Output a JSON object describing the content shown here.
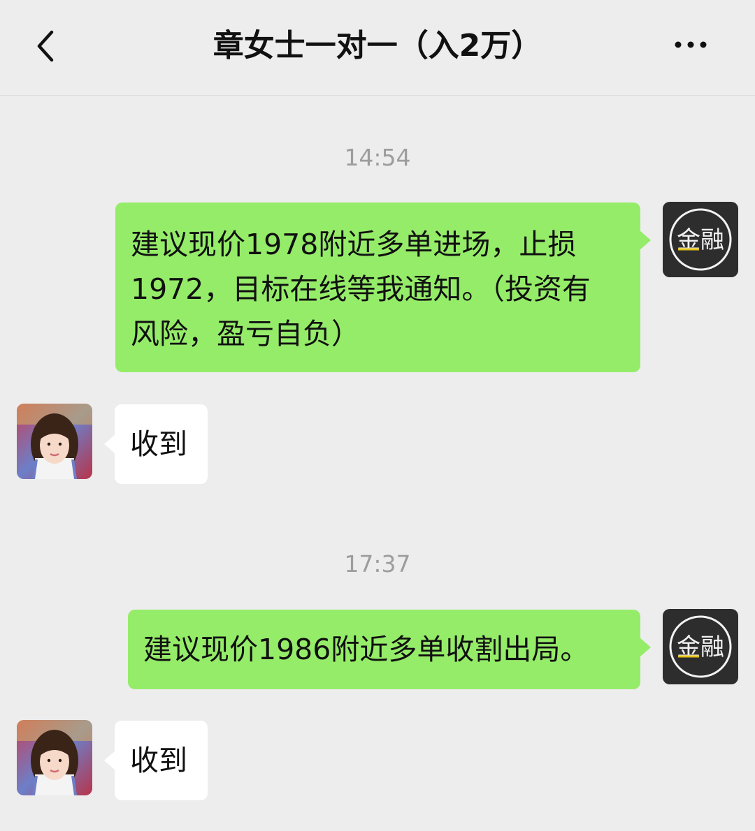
{
  "header": {
    "title": "章女士一对一（入2万）"
  },
  "messages": [
    {
      "type": "time",
      "text": "14:54"
    },
    {
      "type": "outgoing",
      "text": "建议现价1978附近多单进场，止损1972，目标在线等我通知。（投资有风险，盈亏自负）"
    },
    {
      "type": "incoming",
      "text": "收到"
    },
    {
      "type": "time",
      "text": "17:37"
    },
    {
      "type": "outgoing",
      "text": "建议现价1986附近多单收割出局。"
    },
    {
      "type": "incoming",
      "text": "收到"
    }
  ],
  "self_avatar": {
    "logo_text": "金融",
    "icon": "finance-logo"
  },
  "contact_avatar": {
    "icon": "woman-portrait"
  },
  "colors": {
    "background": "#ededed",
    "outgoing_bubble": "#95ec69",
    "incoming_bubble": "#ffffff",
    "time_text": "#9d9d9d",
    "logo_bg": "#2d2d2d",
    "logo_accent": "#e4c21b"
  }
}
